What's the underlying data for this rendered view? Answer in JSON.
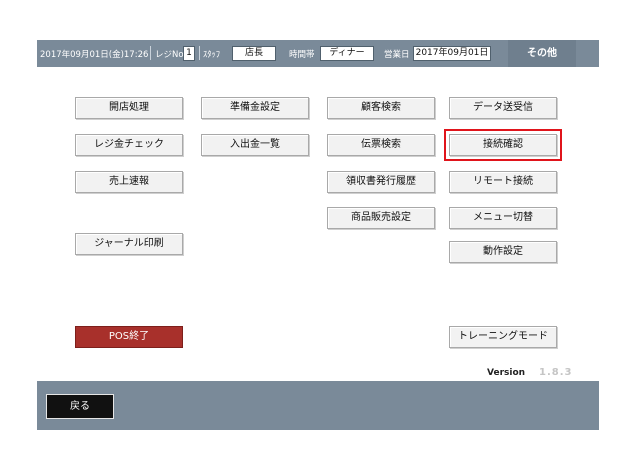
{
  "header": {
    "datetime": "2017年09月01日(金)17:26",
    "register_label": "レジNo",
    "register_no": "1",
    "staff_label": "ｽﾀｯﾌ",
    "staff_value": "店長",
    "timezone_label": "時間帯",
    "timezone_value": "ディナー",
    "business_date_label": "営業日",
    "business_date_value": "2017年09月01日",
    "other_label": "その他"
  },
  "menu": {
    "col1": [
      "開店処理",
      "レジ金チェック",
      "売上速報",
      "ジャーナル印刷"
    ],
    "col2": [
      "準備金設定",
      "入出金一覧"
    ],
    "col3": [
      "顧客検索",
      "伝票検索",
      "領収書発行履歴",
      "商品販売設定"
    ],
    "col4": [
      "データ送受信",
      "接続確認",
      "リモート接続",
      "メニュー切替",
      "動作設定",
      "トレーニングモード"
    ],
    "pos_exit": "POS終了"
  },
  "highlighted_item": "接続確認",
  "version": {
    "label": "Version",
    "number": "1.8.3"
  },
  "footer": {
    "back_label": "戻る"
  },
  "colors": {
    "bar": "#7a8a99",
    "exit_button": "#a8302b",
    "highlight_outline": "#e0141b"
  }
}
